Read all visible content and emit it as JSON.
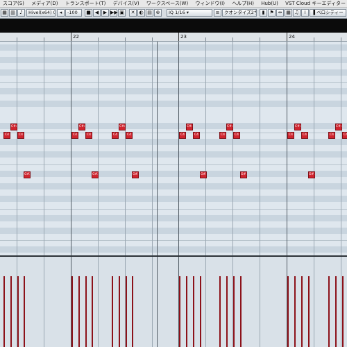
{
  "menubar": {
    "items": [
      "スコア(S)",
      "メディア(D)",
      "トランスポート(T)",
      "デバイス(V)",
      "ワークスペース(W)",
      "ウィンドウ(I)",
      "ヘルプ(H)",
      "Hub(U)",
      "VST Cloud"
    ],
    "right_text": "キーエディター"
  },
  "toolbar": {
    "part_name": "Hivel(x64) 02 -",
    "zoom_value": "100",
    "quantize_value": "1/16",
    "quantize_preset": "クオンタイズ2サン",
    "velocity_label": "ベロシティー"
  },
  "ruler": {
    "bars": [
      "22",
      "23",
      "24"
    ]
  },
  "notes": {
    "labels": [
      "C4",
      "C#4",
      "C4",
      "C4",
      "C#4",
      "C4",
      "C4",
      "C#4",
      "C4",
      "C4",
      "C#4",
      "C4",
      "C4",
      "C#4",
      "C4",
      "C4",
      "C#4",
      "C4",
      "C4",
      "C#4",
      "C4",
      "G#3",
      "G#3",
      "G#3",
      "G#3",
      "G#3",
      "G#3"
    ]
  },
  "colors": {
    "note": "#d0252f",
    "velocity": "#8c1119",
    "grid_bg": "#dfe7ee"
  }
}
